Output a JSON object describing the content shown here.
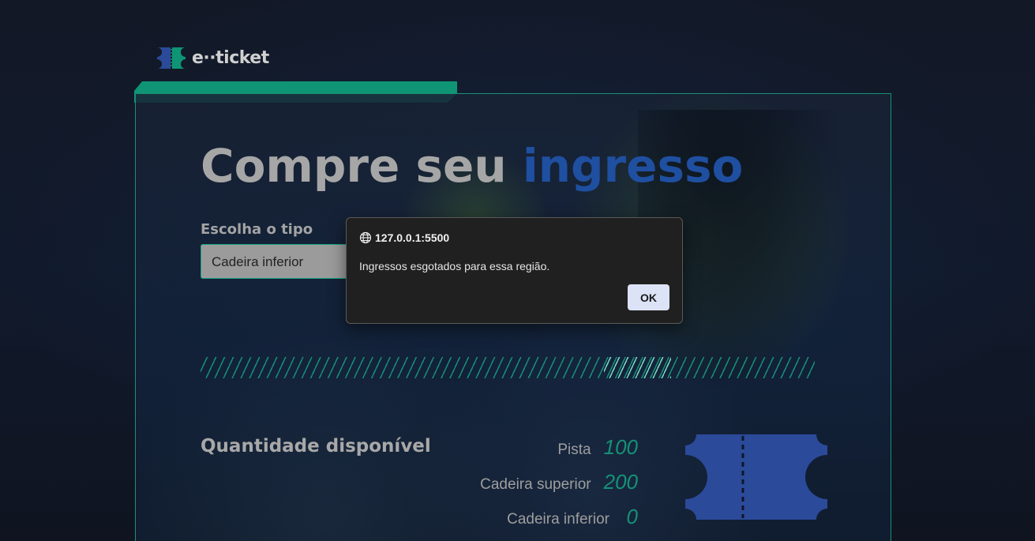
{
  "colors": {
    "accent_green": "#0f9575",
    "accent_blue": "#1f4fa0",
    "ticket_blue": "#2b4a9a"
  },
  "logo": {
    "text": "e··ticket",
    "icon": "ticket-logo-icon"
  },
  "hero": {
    "headline_part1": "Compre seu ",
    "headline_accent": "ingresso"
  },
  "ticket_form": {
    "select_label": "Escolha o tipo",
    "selected_value": "Cadeira inferior"
  },
  "availability": {
    "title": "Quantidade disponível",
    "rows": [
      {
        "name": "Pista",
        "value": "100"
      },
      {
        "name": "Cadeira superior",
        "value": "200"
      },
      {
        "name": "Cadeira inferior",
        "value": "0"
      }
    ],
    "icon": "ticket-icon"
  },
  "alert_dialog": {
    "origin": "127.0.0.1:5500",
    "message": "Ingressos esgotados para essa região.",
    "ok_label": "OK",
    "icon": "globe-icon"
  }
}
